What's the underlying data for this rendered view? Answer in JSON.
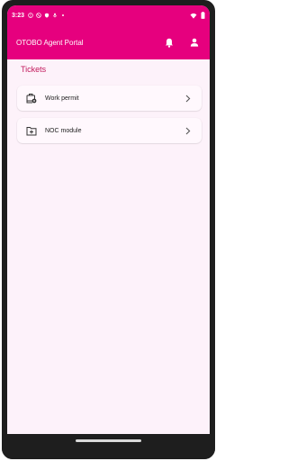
{
  "status": {
    "time": "3:23",
    "left_icons": [
      "alert-circle-icon",
      "block-icon",
      "shield-icon",
      "mic-icon",
      "dot-icon"
    ],
    "right_icons": [
      "wifi-icon",
      "battery-icon"
    ]
  },
  "app_bar": {
    "title": "OTOBO Agent Portal",
    "actions": [
      "notifications-bell-icon",
      "profile-person-icon"
    ]
  },
  "tickets": {
    "title": "Tickets",
    "items": [
      {
        "label": "Work permit",
        "icon": "ticket-settings-icon"
      },
      {
        "label": "NOC module",
        "icon": "folder-add-icon"
      }
    ]
  },
  "colors": {
    "primary": "#e6007e",
    "section_title": "#c2185b",
    "background": "#fdf2fa"
  }
}
